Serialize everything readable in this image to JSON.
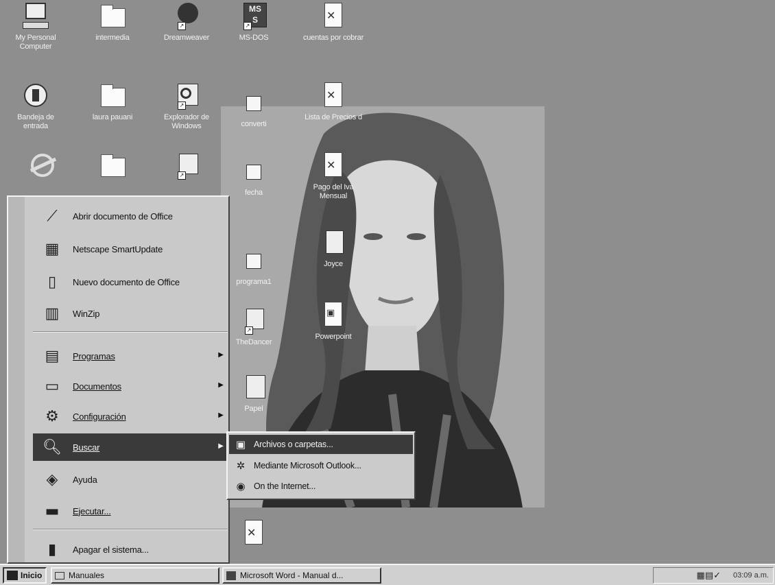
{
  "desktop": {
    "icons": [
      {
        "label": "My Personal Computer",
        "icon": "computer-icon"
      },
      {
        "label": "intermedia",
        "icon": "folder-icon"
      },
      {
        "label": "Dreamweaver",
        "icon": "dreamweaver-icon"
      },
      {
        "label": "MS-DOS",
        "icon": "msdos-icon"
      },
      {
        "label": "cuentas por cobrar",
        "icon": "excel-document-icon"
      },
      {
        "label": "Bandeja de entrada",
        "icon": "inbox-icon"
      },
      {
        "label": "laura pauani",
        "icon": "folder-icon"
      },
      {
        "label": "Explorador de Windows",
        "icon": "windows-explorer-icon"
      },
      {
        "label": "converti",
        "icon": "file-shortcut-icon"
      },
      {
        "label": "Lista de Precios d",
        "icon": "excel-document-icon"
      },
      {
        "label": "",
        "icon": "internet-explorer-icon"
      },
      {
        "label": "",
        "icon": "folder-icon"
      },
      {
        "label": "",
        "icon": "program-shortcut-icon"
      },
      {
        "label": "fecha",
        "icon": "file-shortcut-icon"
      },
      {
        "label": "Pago del Iva Mensual",
        "icon": "excel-document-icon"
      },
      {
        "label": "programa1",
        "icon": "file-shortcut-icon"
      },
      {
        "label": "Joyce",
        "icon": "application-icon"
      },
      {
        "label": "TheDancer",
        "icon": "program-shortcut-icon"
      },
      {
        "label": "Powerpoint",
        "icon": "powerpoint-document-icon"
      },
      {
        "label": "Papel",
        "icon": "application-icon"
      },
      {
        "label": "",
        "icon": "excel-document-icon"
      }
    ]
  },
  "start_menu": {
    "items": [
      {
        "label": "Abrir documento de Office",
        "icon": "open-office-document-icon"
      },
      {
        "label": "Netscape SmartUpdate",
        "icon": "netscape-smartupdate-icon"
      },
      {
        "label": "Nuevo documento de Office",
        "icon": "new-office-document-icon"
      },
      {
        "label": "WinZip",
        "icon": "winzip-icon"
      },
      {
        "label": "Programas",
        "icon": "programs-icon"
      },
      {
        "label": "Documentos",
        "icon": "documents-icon"
      },
      {
        "label": "Configuración",
        "icon": "settings-icon"
      },
      {
        "label": "Buscar",
        "icon": "find-icon"
      },
      {
        "label": "Ayuda",
        "icon": "help-icon"
      },
      {
        "label": "Ejecutar...",
        "icon": "run-icon"
      },
      {
        "label": "Apagar el sistema...",
        "icon": "shutdown-icon"
      }
    ]
  },
  "submenu": {
    "items": [
      {
        "label": "Archivos o carpetas...",
        "icon": "files-or-folders-icon"
      },
      {
        "label": "Mediante Microsoft Outlook...",
        "icon": "outlook-icon"
      },
      {
        "label": "On the Internet...",
        "icon": "internet-search-icon"
      }
    ]
  },
  "taskbar": {
    "start_label": "Inicio",
    "buttons": [
      {
        "label": "Manuales"
      },
      {
        "label": "Microsoft Word - Manual d..."
      }
    ],
    "clock": "03:09 a.m."
  },
  "colors": {
    "desktop": "#8e8e8e",
    "menu": "#c9c9c9",
    "highlight": "#3a3a3a",
    "taskbar": "#d0d0d0"
  }
}
